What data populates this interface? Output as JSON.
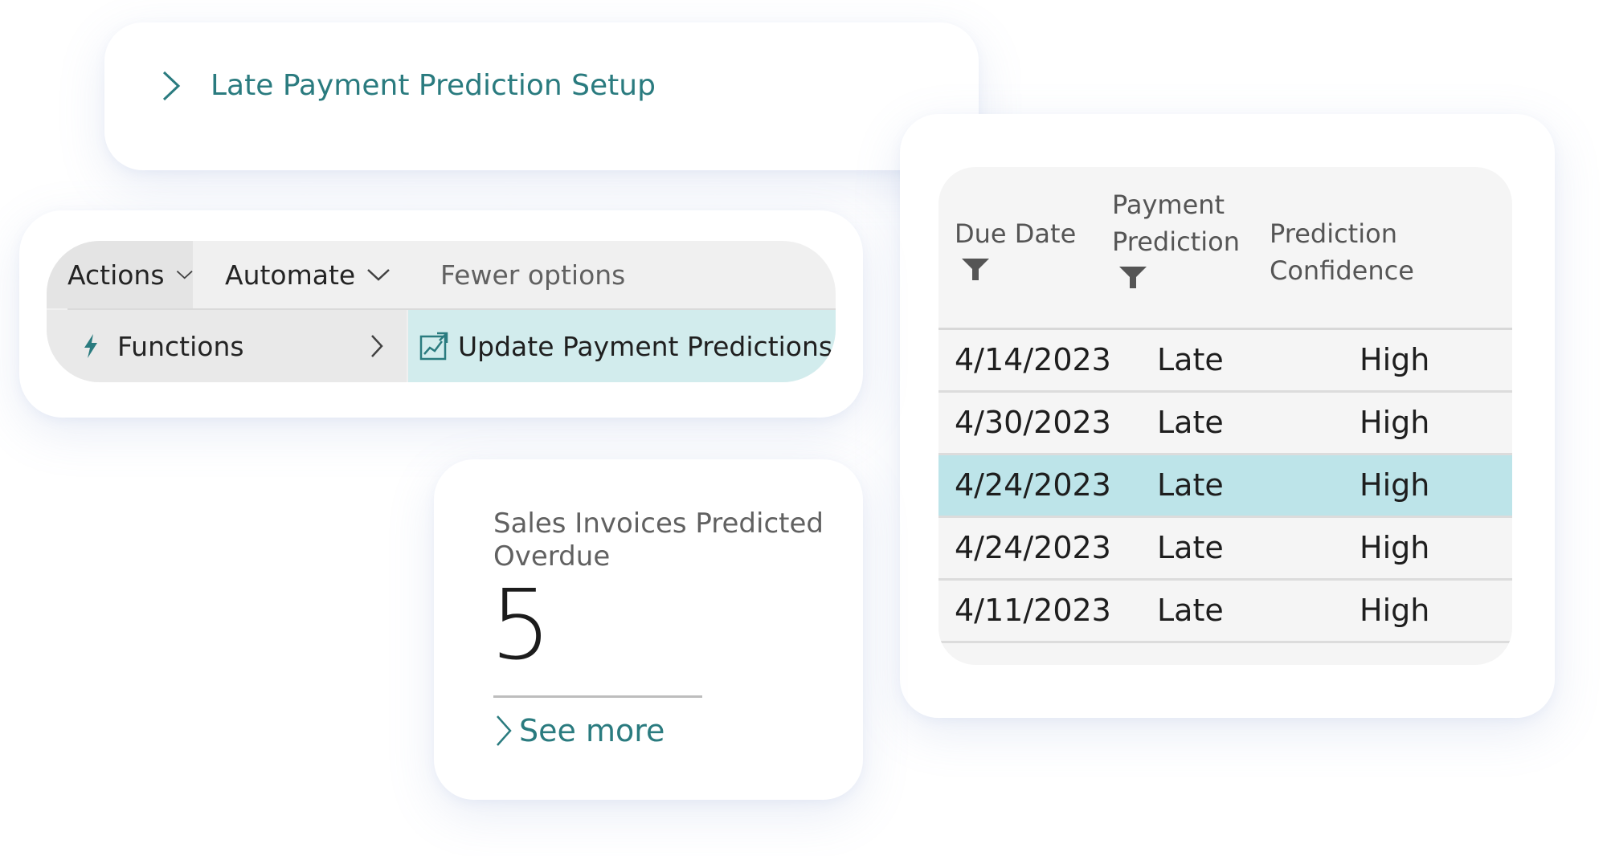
{
  "setup_card": {
    "link_label": "Late Payment Prediction Setup"
  },
  "action_bar": {
    "actions_label": "Actions",
    "automate_label": "Automate",
    "fewer_options_label": "Fewer options",
    "functions_label": "Functions",
    "update_label": "Update Payment Predictions"
  },
  "kpi": {
    "title": "Sales Invoices Predicted Overdue",
    "value": "5",
    "see_more_label": "See more"
  },
  "table": {
    "headers": {
      "due_date_line1": "Due Date",
      "payment_prediction_line1": "Payment",
      "payment_prediction_line2": "Prediction",
      "prediction_confidence_line1": "Prediction",
      "prediction_confidence_line2": "Confidence"
    },
    "rows": [
      {
        "due_date": "4/14/2023",
        "payment_prediction": "Late",
        "confidence": "High"
      },
      {
        "due_date": "4/30/2023",
        "payment_prediction": "Late",
        "confidence": "High"
      },
      {
        "due_date": "4/24/2023",
        "payment_prediction": "Late",
        "confidence": "High"
      },
      {
        "due_date": "4/24/2023",
        "payment_prediction": "Late",
        "confidence": "High"
      },
      {
        "due_date": "4/11/2023",
        "payment_prediction": "Late",
        "confidence": "High"
      }
    ],
    "selected_row_index": 2
  },
  "colors": {
    "accent_teal": "#2a7b7f",
    "selected_row": "#bde4e9",
    "highlight_menu": "#d2eced"
  },
  "icons": {
    "setup_chevron": "chevron-right-icon",
    "menu_chevron": "chevron-down-icon",
    "functions_icon": "lightning-icon",
    "update_icon": "update-predictions-icon",
    "filter_icon": "funnel-icon",
    "see_more_chevron": "chevron-right-icon"
  }
}
